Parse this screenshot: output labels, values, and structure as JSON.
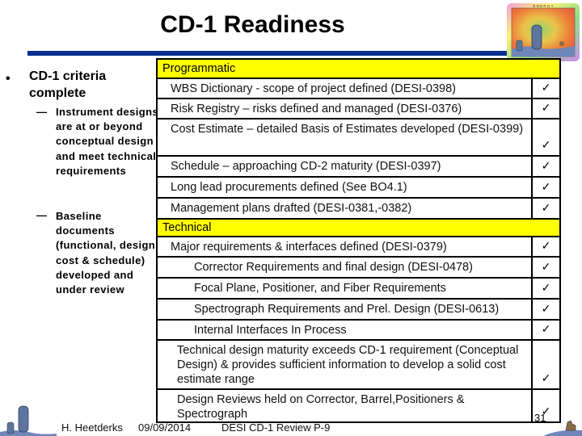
{
  "slide": {
    "title": "CD-1 Readiness",
    "accent_color": "#0a2f91",
    "section_color": "#ffff00"
  },
  "left_panel": {
    "bullet_symbol": "•",
    "main_bullet": "CD-1 criteria complete",
    "sub_dash": "—",
    "sub_bullets": [
      "Instrument designs are at or beyond conceptual design and meet technical requirements",
      "Baseline documents (functional, design, cost & schedule) developed and under review"
    ]
  },
  "table": {
    "check_symbol": "✓",
    "sections": [
      {
        "title": "Programmatic",
        "rows": [
          {
            "text": "WBS Dictionary -  scope of project defined  (DESI-0398)",
            "checked": true
          },
          {
            "text": "Risk Registry – risks defined and managed  (DESI-0376)",
            "checked": true
          },
          {
            "text": "Cost Estimate – detailed Basis of Estimates developed (DESI-0399)",
            "checked": true
          },
          {
            "text": "Schedule –  approaching CD-2 maturity  (DESI-0397)",
            "checked": true
          },
          {
            "text": "Long lead procurements defined  (See BO4.1)",
            "checked": true
          },
          {
            "text": "Management plans drafted  (DESI-0381,-0382)",
            "checked": true
          }
        ]
      },
      {
        "title": "Technical",
        "rows": [
          {
            "text": "Major requirements & interfaces defined  (DESI-0379)",
            "checked": true
          },
          {
            "text": "Corrector Requirements and final design (DESI-0478)",
            "checked": true
          },
          {
            "text": "Focal Plane, Positioner, and Fiber Requirements",
            "checked": true
          },
          {
            "text": "Spectrograph Requirements and Prel. Design (DESI-0613)",
            "checked": true
          },
          {
            "text": "Internal Interfaces In Process",
            "checked": true
          },
          {
            "text": "Technical design maturity exceeds CD-1 requirement (Conceptual Design) & provides sufficient information to develop a solid cost estimate range",
            "checked": true
          },
          {
            "text": "Design Reviews held on Corrector, Barrel,Positioners & Spectrograph",
            "checked": true
          }
        ]
      }
    ]
  },
  "footer": {
    "author": "H. Heetderks",
    "date": "09/09/2014",
    "event": "DESI CD-1 Review  P-9",
    "page_number": "31"
  },
  "logo": {
    "label": "DARK ENERGY SPECTROSCOPIC INSTRUMENT"
  }
}
